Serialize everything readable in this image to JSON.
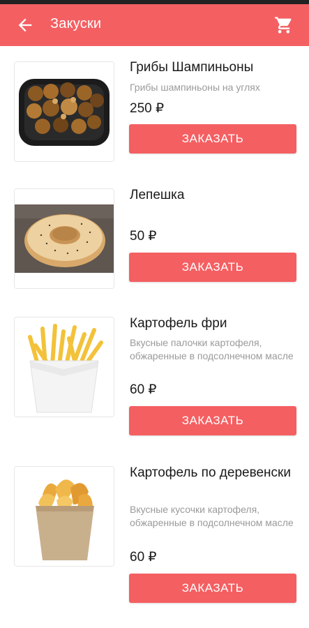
{
  "header": {
    "title": "Закуски",
    "back_icon": "arrow-left-icon",
    "cart_icon": "shopping-cart-icon"
  },
  "colors": {
    "accent": "#f45f62",
    "text": "#1a1a1a",
    "muted": "#9a9a9a"
  },
  "products": [
    {
      "name": "Грибы Шампиньоны",
      "desc": "Грибы шампиньоны на углях",
      "price": "250 ₽",
      "button": "ЗАКАЗАТЬ"
    },
    {
      "name": "Лепешка",
      "desc": "",
      "price": "50 ₽",
      "button": "ЗАКАЗАТЬ"
    },
    {
      "name": "Картофель фри",
      "desc": "Вкусные палочки картофеля, обжаренные в подсолнечном масле",
      "price": "60 ₽",
      "button": "ЗАКАЗАТЬ"
    },
    {
      "name": "Картофель по деревенски",
      "desc": "Вкусные кусочки картофеля, обжаренные в подсолнечном масле",
      "price": "60 ₽",
      "button": "ЗАКАЗАТЬ"
    }
  ]
}
